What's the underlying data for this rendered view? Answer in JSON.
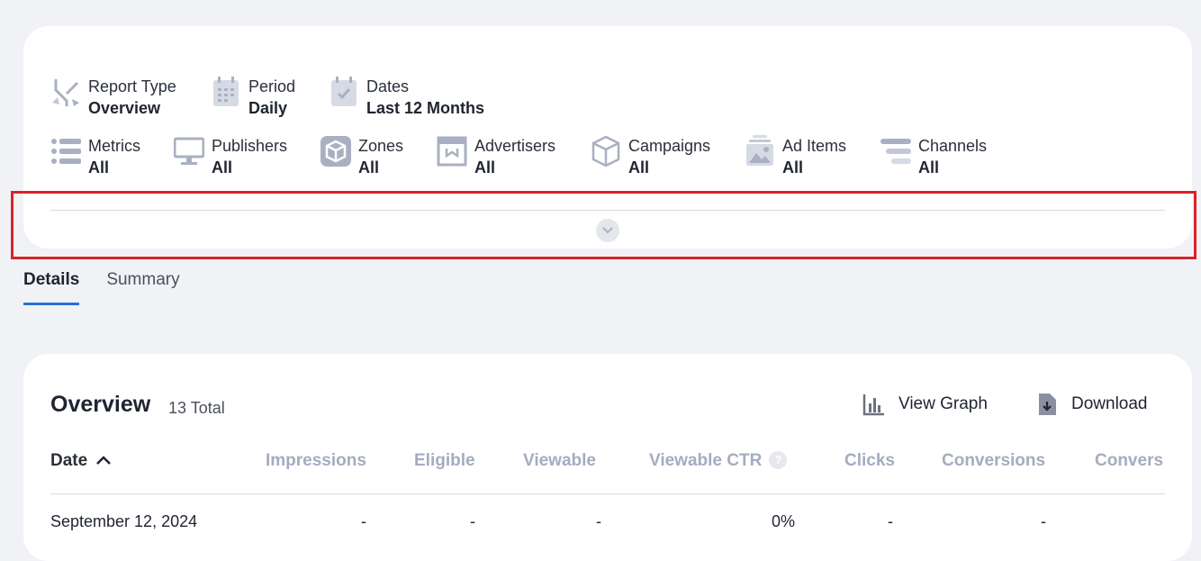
{
  "filters_row1": [
    {
      "label": "Report Type",
      "value": "Overview",
      "icon": "report-type-icon"
    },
    {
      "label": "Period",
      "value": "Daily",
      "icon": "calendar-icon"
    },
    {
      "label": "Dates",
      "value": "Last 12 Months",
      "icon": "calendar-check-icon"
    }
  ],
  "filters_row2": [
    {
      "label": "Metrics",
      "value": "All",
      "icon": "list-icon"
    },
    {
      "label": "Publishers",
      "value": "All",
      "icon": "monitor-icon"
    },
    {
      "label": "Zones",
      "value": "All",
      "icon": "cube-box-icon"
    },
    {
      "label": "Advertisers",
      "value": "All",
      "icon": "frame-icon"
    },
    {
      "label": "Campaigns",
      "value": "All",
      "icon": "cube-outline-icon"
    },
    {
      "label": "Ad Items",
      "value": "All",
      "icon": "image-stack-icon"
    },
    {
      "label": "Channels",
      "value": "All",
      "icon": "channels-icon"
    }
  ],
  "tabs": [
    {
      "label": "Details",
      "active": true
    },
    {
      "label": "Summary",
      "active": false
    }
  ],
  "overview": {
    "title": "Overview",
    "count": "13 Total",
    "view_graph": "View Graph",
    "download": "Download"
  },
  "table": {
    "columns": [
      "Date",
      "Impressions",
      "Eligible",
      "Viewable",
      "Viewable CTR",
      "Clicks",
      "Conversions",
      "Convers"
    ],
    "help_mark": "?",
    "rows": [
      [
        "September 12, 2024",
        "-",
        "-",
        "-",
        "0%",
        "-",
        "-"
      ]
    ]
  },
  "colors": {
    "accent": "#2a6fdb",
    "highlight": "#d9232a",
    "header_muted": "#a5acc0",
    "icon": "#a9b0c3"
  }
}
